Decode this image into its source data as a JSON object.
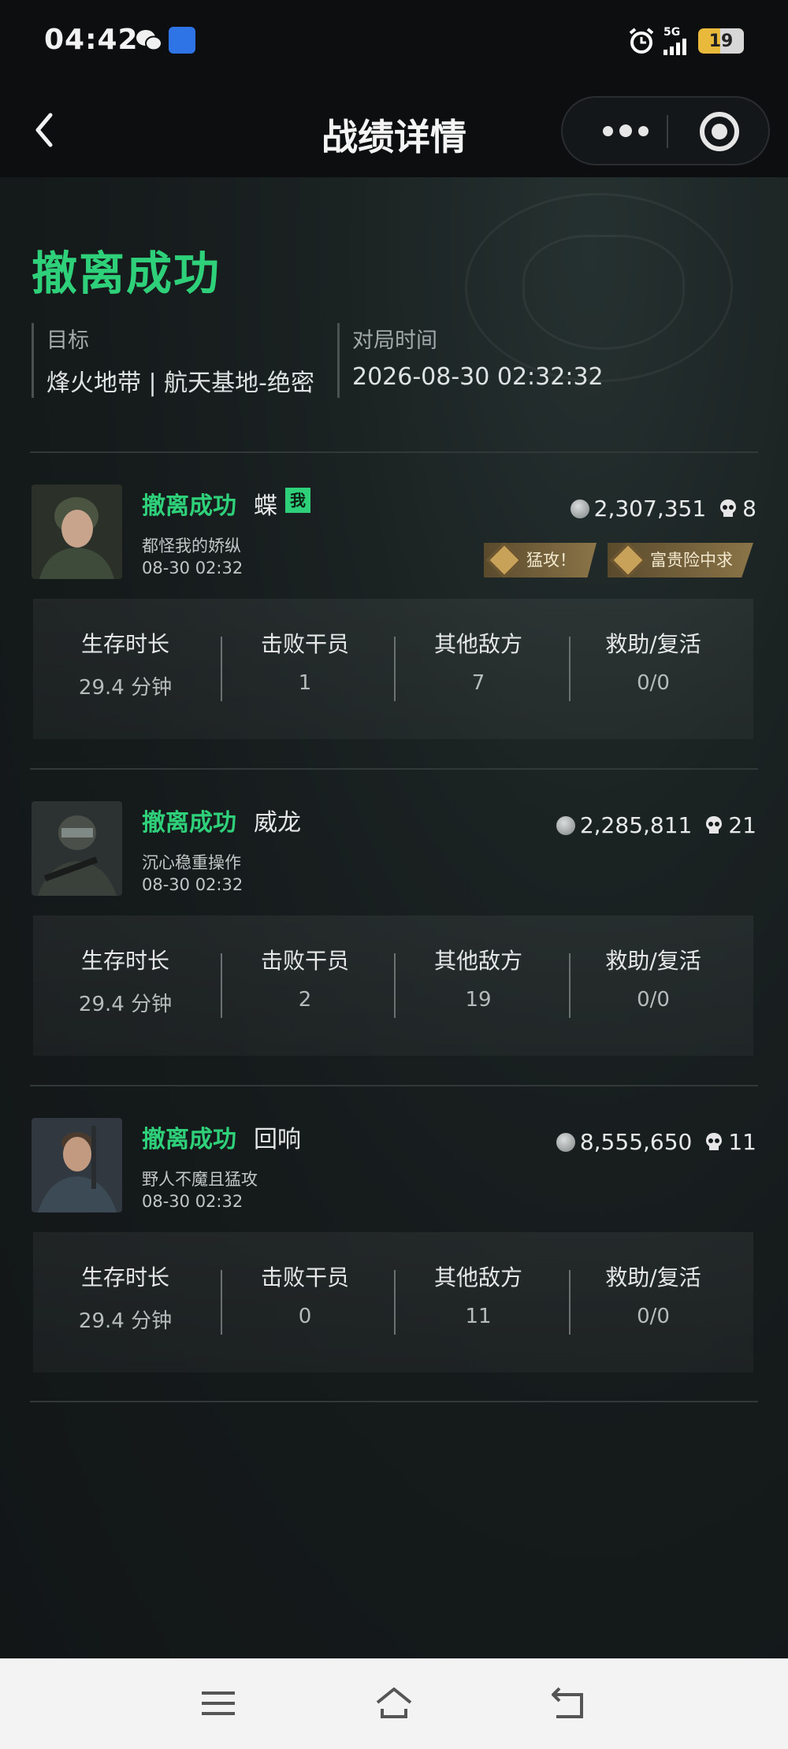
{
  "status_bar": {
    "time": "04:42",
    "network": "5G",
    "battery": "19"
  },
  "nav": {
    "title": "战绩详情"
  },
  "summary": {
    "result": "撤离成功",
    "target_label": "目标",
    "target_value": "烽火地带 | 航天基地-绝密",
    "time_label": "对局时间",
    "time_value": "2026-08-30 02:32:32"
  },
  "stat_labels": {
    "survival": "生存时长",
    "defeated": "击败干员",
    "other_enemies": "其他敌方",
    "assist": "救助/复活"
  },
  "players": [
    {
      "status": "撤离成功",
      "name": "蝶",
      "me_tag": "我",
      "motto": "都怪我的娇纵",
      "time": "08-30 02:32",
      "value": "2,307,351",
      "kills": "8",
      "badges": [
        "猛攻！",
        "富贵险中求"
      ],
      "survival": "29.4 分钟",
      "defeated": "1",
      "other_enemies": "7",
      "assist": "0/0"
    },
    {
      "status": "撤离成功",
      "name": "威龙",
      "motto": "沉心稳重操作",
      "time": "08-30 02:32",
      "value": "2,285,811",
      "kills": "21",
      "survival": "29.4 分钟",
      "defeated": "2",
      "other_enemies": "19",
      "assist": "0/0"
    },
    {
      "status": "撤离成功",
      "name": "回响",
      "motto": "野人不魔且猛攻",
      "time": "08-30 02:32",
      "value": "8,555,650",
      "kills": "11",
      "survival": "29.4 分钟",
      "defeated": "0",
      "other_enemies": "11",
      "assist": "0/0"
    }
  ],
  "colors": {
    "accent": "#2fd07a",
    "badge_gold": "#8a7448",
    "background": "#151a1b"
  },
  "icons": [
    "wechat-icon",
    "radio-icon",
    "alarm-icon",
    "signal-icon",
    "back-icon",
    "more-icon",
    "close-circle-icon",
    "coin-icon",
    "skull-icon",
    "badge-icon",
    "menu-icon",
    "home-icon",
    "return-icon"
  ]
}
